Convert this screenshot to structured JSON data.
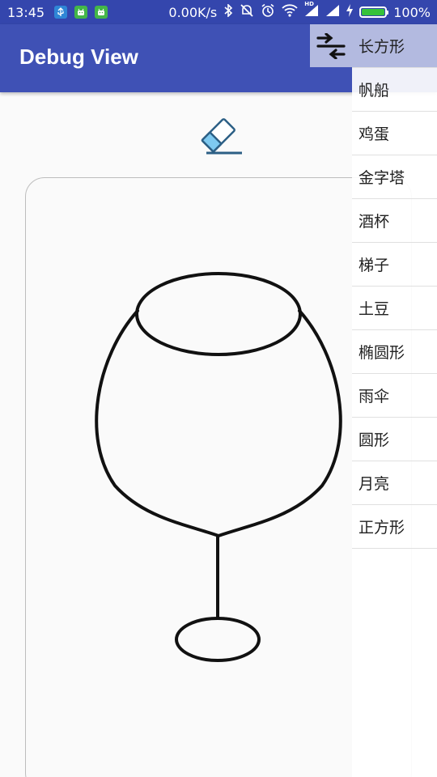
{
  "status_bar": {
    "time": "13:45",
    "network_speed": "0.00K/s",
    "battery_percent": "100%",
    "signal_label": "HD",
    "icons": [
      "usb-icon",
      "android-debug-icon",
      "android-debug-icon",
      "bluetooth-icon",
      "mute-icon",
      "alarm-icon",
      "wifi-icon",
      "signal-icon",
      "signal-icon",
      "charging-icon",
      "battery-icon"
    ],
    "colors": {
      "background": "#3446ad",
      "battery_fill": "#36c23a"
    }
  },
  "app_bar": {
    "title": "Debug View",
    "color": "#3f51b5"
  },
  "toolbar": {
    "eraser_icon": "eraser-icon",
    "toggle_icon": "swap-arrows-icon"
  },
  "shape_list": {
    "selected_index": 0,
    "highlight_color": "#b3bae0",
    "items": [
      {
        "label": "长方形"
      },
      {
        "label": "帆船"
      },
      {
        "label": "鸡蛋"
      },
      {
        "label": "金字塔"
      },
      {
        "label": "酒杯"
      },
      {
        "label": "梯子"
      },
      {
        "label": "土豆"
      },
      {
        "label": "椭圆形"
      },
      {
        "label": "雨伞"
      },
      {
        "label": "圆形"
      },
      {
        "label": "月亮"
      },
      {
        "label": "正方形"
      }
    ]
  },
  "drawing": {
    "subject": "wine-glass-sketch",
    "stroke_color": "#111111"
  }
}
